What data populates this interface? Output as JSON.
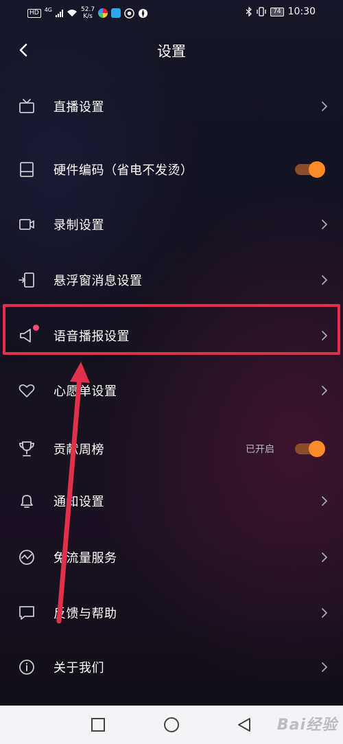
{
  "status_bar": {
    "hd": "HD",
    "network": "4G",
    "speed_value": "52.7",
    "speed_unit": "K/s",
    "battery": "74",
    "time": "10:30"
  },
  "header": {
    "title": "设置"
  },
  "settings": {
    "items": [
      {
        "label": "直播设置",
        "icon": "tv-icon",
        "trailing": "chevron"
      },
      {
        "label": "硬件编码（省电不发烫）",
        "icon": "panel-icon",
        "trailing": "toggle",
        "toggle_on": true
      },
      {
        "label": "录制设置",
        "icon": "camera-icon",
        "trailing": "chevron"
      },
      {
        "label": "悬浮窗消息设置",
        "icon": "floating-window-icon",
        "trailing": "chevron"
      },
      {
        "label": "语音播报设置",
        "icon": "speaker-icon",
        "trailing": "chevron",
        "badge_dot": true
      },
      {
        "label": "心愿单设置",
        "icon": "heart-icon",
        "trailing": "chevron"
      },
      {
        "label": "贡献周榜",
        "icon": "trophy-icon",
        "trailing": "toggle",
        "status": "已开启",
        "toggle_on": true
      },
      {
        "label": "通知设置",
        "icon": "bell-icon",
        "trailing": "chevron"
      },
      {
        "label": "免流量服务",
        "icon": "traffic-icon",
        "trailing": "chevron"
      },
      {
        "label": "反馈与帮助",
        "icon": "message-icon",
        "trailing": "chevron"
      },
      {
        "label": "关于我们",
        "icon": "info-icon",
        "trailing": "chevron"
      }
    ]
  },
  "watermark": "Bai经验",
  "colors": {
    "accent_toggle": "#ff8a2a",
    "highlight_box": "#e0304b",
    "badge_dot": "#ff4a6d"
  }
}
